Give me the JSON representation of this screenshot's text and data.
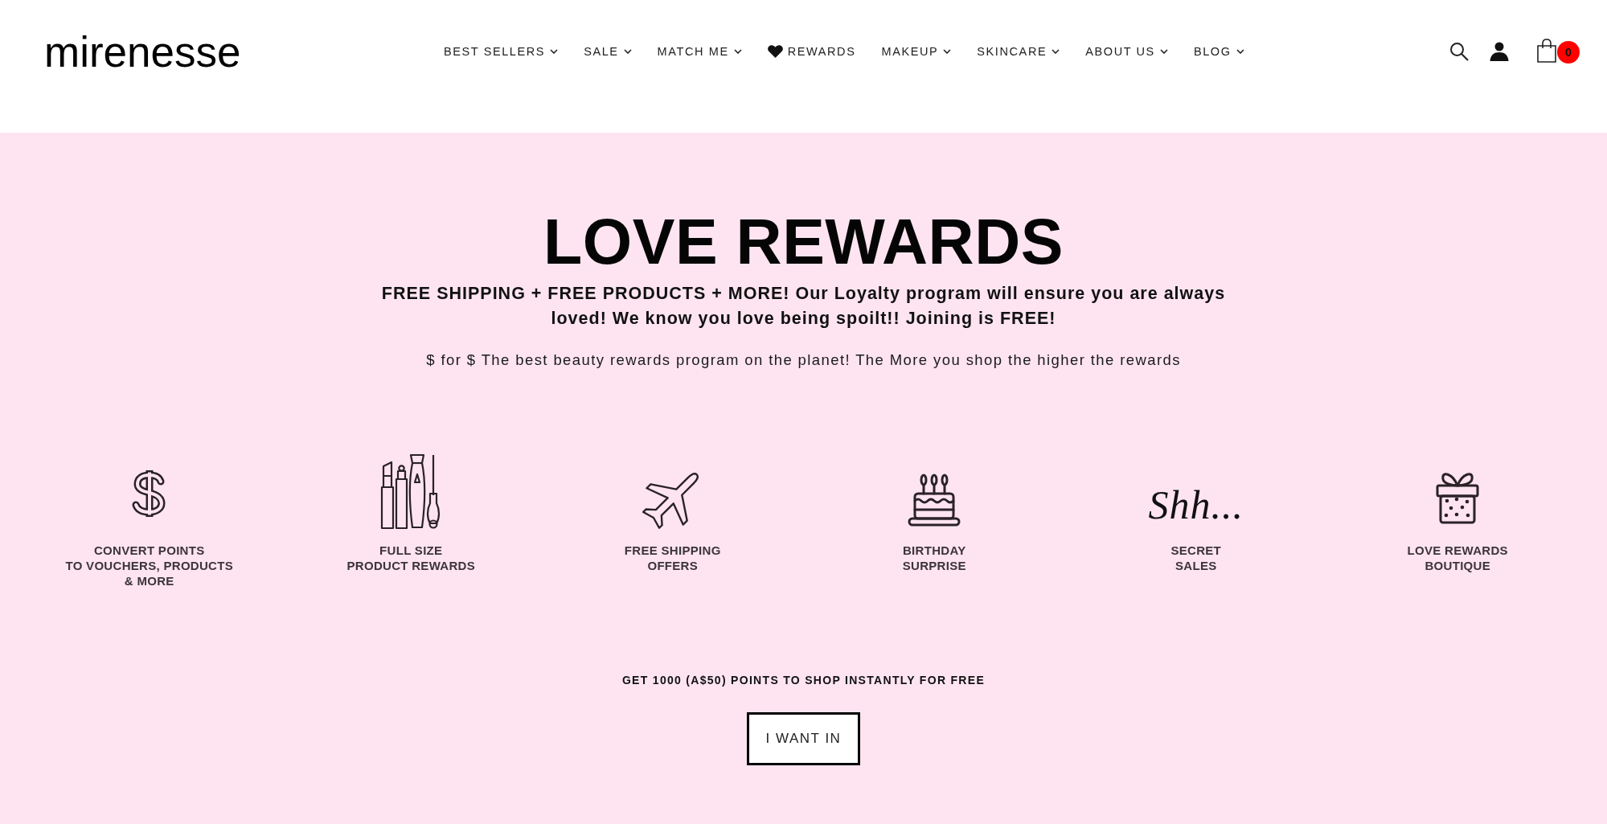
{
  "header": {
    "logo": "mirenesse",
    "nav": [
      {
        "label": "BEST SELLERS",
        "kind": "dropdown"
      },
      {
        "label": "SALE",
        "kind": "dropdown"
      },
      {
        "label": "MATCH ME",
        "kind": "dropdown"
      },
      {
        "label": "REWARDS",
        "kind": "featured"
      },
      {
        "label": "MAKEUP",
        "kind": "dropdown"
      },
      {
        "label": "SKINCARE",
        "kind": "dropdown"
      },
      {
        "label": "ABOUT US",
        "kind": "dropdown"
      },
      {
        "label": "BLOG",
        "kind": "dropdown"
      }
    ],
    "cart": {
      "count": "0"
    }
  },
  "hero": {
    "title": "LOVE REWARDS",
    "lead": "FREE SHIPPING + FREE PRODUCTS + MORE! Our Loyalty program will ensure you are always loved! We know you love being spoilt!! Joining is FREE!",
    "tagline": "$ for $ The best beauty rewards program on the planet! The More you shop the higher the rewards"
  },
  "benefits": [
    {
      "kind": "icon",
      "label_lines": [
        "CONVERT POINTS",
        "TO VOUCHERS, PRODUCTS",
        "& MORE"
      ]
    },
    {
      "kind": "icon",
      "label_lines": [
        "FULL SIZE",
        "PRODUCT REWARDS"
      ]
    },
    {
      "kind": "icon",
      "label_lines": [
        "FREE SHIPPING",
        "OFFERS"
      ]
    },
    {
      "kind": "icon",
      "label_lines": [
        "BIRTHDAY",
        "SURPRISE"
      ]
    },
    {
      "kind": "script",
      "script_text": "Shh...",
      "label_lines": [
        "SECRET",
        "SALES"
      ]
    },
    {
      "kind": "icon",
      "label_lines": [
        "LOVE REWARDS",
        "BOUTIQUE"
      ]
    }
  ],
  "cta": {
    "text": "GET 1000 (A$50) POINTS TO SHOP INSTANTLY FOR FREE",
    "button": "I WANT IN"
  }
}
